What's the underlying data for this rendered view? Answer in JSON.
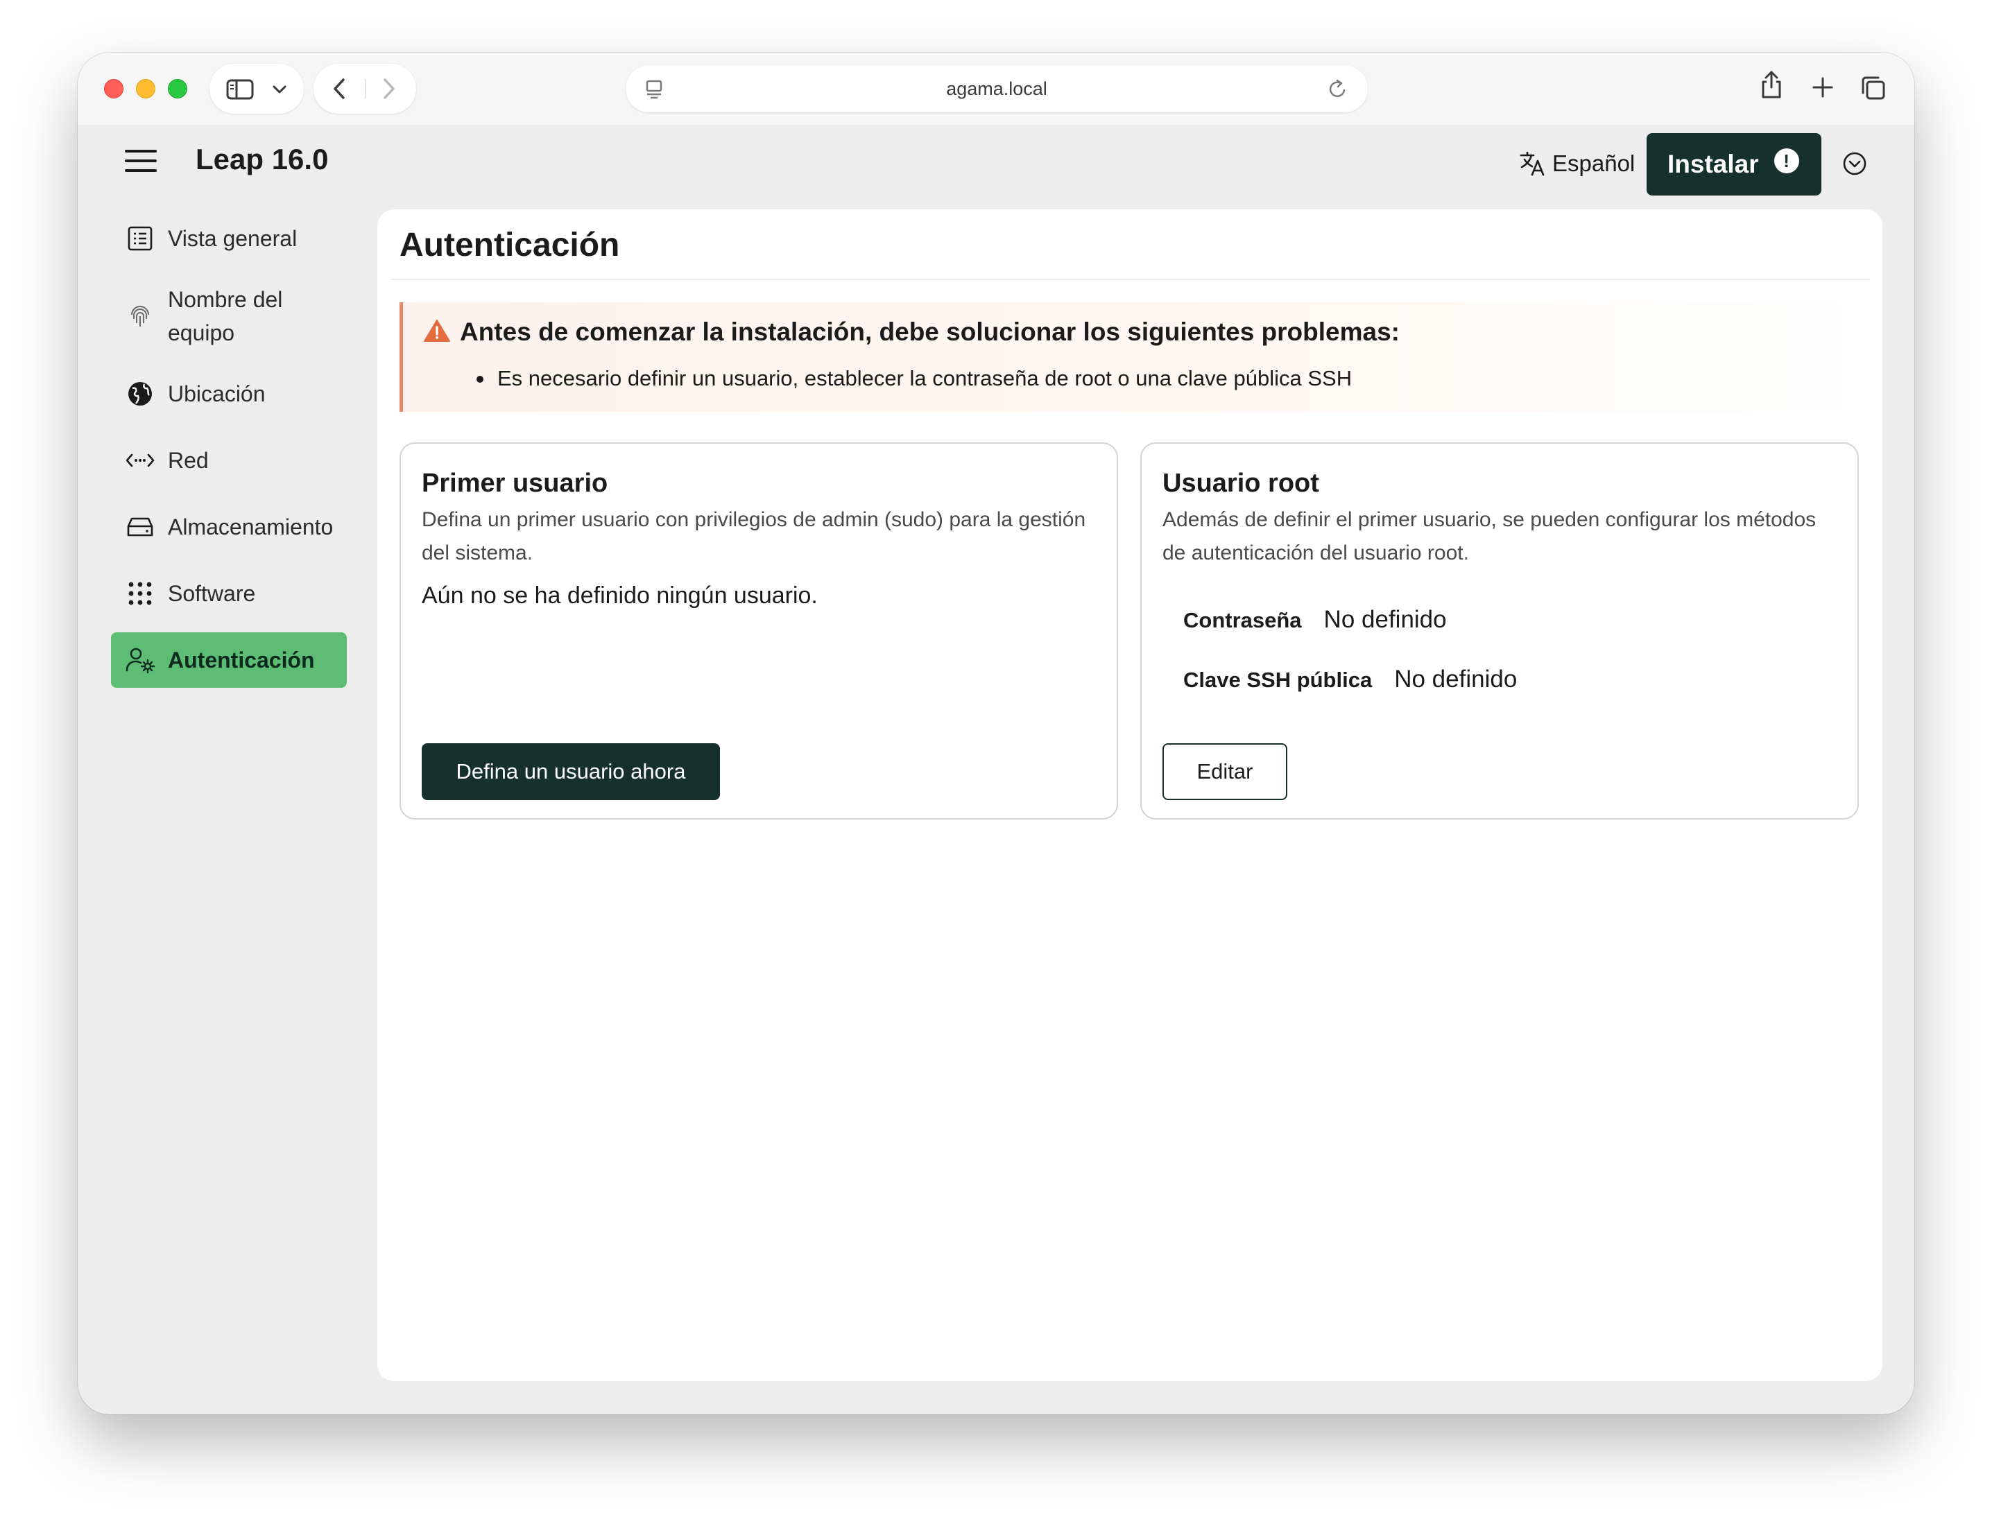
{
  "browser": {
    "address": "agama.local"
  },
  "header": {
    "product_name": "Leap 16.0",
    "language": "Español",
    "install_label": "Instalar",
    "install_warning": "!"
  },
  "sidebar": {
    "items": [
      {
        "label": "Vista general",
        "icon": "list-icon"
      },
      {
        "label": "Nombre del equipo",
        "icon": "fingerprint-icon"
      },
      {
        "label": "Ubicación",
        "icon": "globe-icon"
      },
      {
        "label": "Red",
        "icon": "network-icon"
      },
      {
        "label": "Almacenamiento",
        "icon": "hard-drive-icon"
      },
      {
        "label": "Software",
        "icon": "apps-grid-icon"
      },
      {
        "label": "Autenticación",
        "icon": "user-settings-icon",
        "active": true
      }
    ]
  },
  "page": {
    "title": "Autenticación",
    "alert": {
      "title": "Antes de comenzar la instalación, debe solucionar los siguientes problemas:",
      "items": [
        "Es necesario definir un usuario, establecer la contraseña de root o una clave pública SSH"
      ]
    },
    "first_user": {
      "title": "Primer usuario",
      "description": "Defina un primer usuario con privilegios de admin (sudo) para la gestión del sistema.",
      "status": "Aún no se ha definido ningún usuario.",
      "button": "Defina un usuario ahora"
    },
    "root_user": {
      "title": "Usuario root",
      "description": "Además de definir el primer usuario, se pueden configurar los métodos de autenticación del usuario root.",
      "password_label": "Contraseña",
      "password_value": "No definido",
      "ssh_label": "Clave SSH pública",
      "ssh_value": "No definido",
      "button": "Editar"
    }
  },
  "colors": {
    "primary": "#16312b",
    "active_nav": "#5dbd75",
    "warning": "#e8896a"
  }
}
